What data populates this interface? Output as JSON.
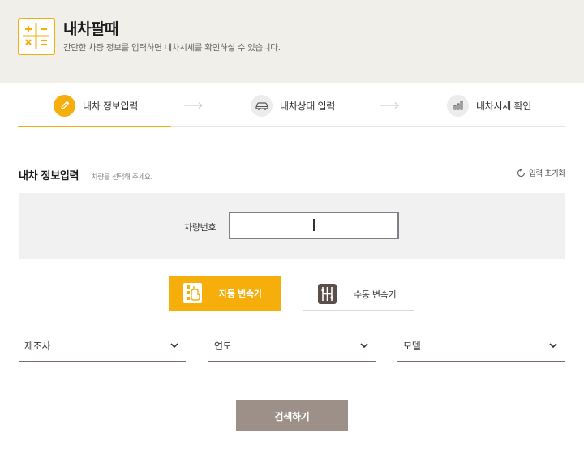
{
  "header": {
    "title": "내차팔때",
    "description": "간단한 차량 정보를 입력하면 내차시세를 확인하실 수 있습니다.",
    "icon": "calculator-icon",
    "accent_color": "#f5ae0c",
    "background_color": "#f1efea"
  },
  "steps": [
    {
      "label": "내차 정보입력",
      "icon": "pencil-icon",
      "active": true
    },
    {
      "label": "내차상태 입력",
      "icon": "car-icon",
      "active": false
    },
    {
      "label": "내차시세 확인",
      "icon": "bar-chart-icon",
      "active": false
    }
  ],
  "section": {
    "title": "내차 정보입력",
    "hint": "차량을 선택해 주세요.",
    "reset_label": "입력 초기화"
  },
  "plate": {
    "label": "차량번호",
    "value": "",
    "placeholder": ""
  },
  "transmission": {
    "auto_label": "자동 변속기",
    "manual_label": "수동 변속기",
    "selected": "auto"
  },
  "selects": {
    "maker": "제조사",
    "year": "연도",
    "model": "모델"
  },
  "search_button": {
    "label": "검색하기",
    "color": "#9c9089"
  }
}
